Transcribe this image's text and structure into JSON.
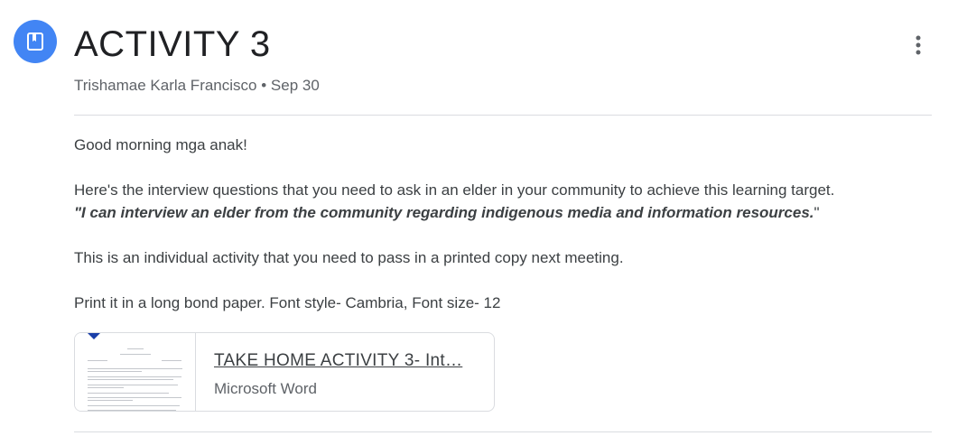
{
  "post": {
    "icon": "assignment-bookmark-icon",
    "title": "ACTIVITY 3",
    "author": "Trishamae Karla Francisco",
    "separator": "•",
    "date": "Sep 30",
    "more_icon": "more-vert-icon"
  },
  "body": {
    "greeting": "Good morning mga anak!",
    "intro": "Here's the interview questions that you need to ask in an elder in your community to achieve this learning target.",
    "target_bold": "\"I can interview an elder from the community regarding indigenous media and information resources.",
    "target_close_quote": "\"",
    "instructions": "This is an individual activity that you need to pass in a printed copy next meeting.",
    "format": "Print it in a long bond paper. Font style- Cambria, Font size- 12"
  },
  "attachment": {
    "title": "TAKE HOME ACTIVITY 3- Int…",
    "type": "Microsoft Word"
  },
  "colors": {
    "accent": "#4285f4",
    "divider": "#dadce0",
    "doc_marker": "#1a3fa8"
  }
}
